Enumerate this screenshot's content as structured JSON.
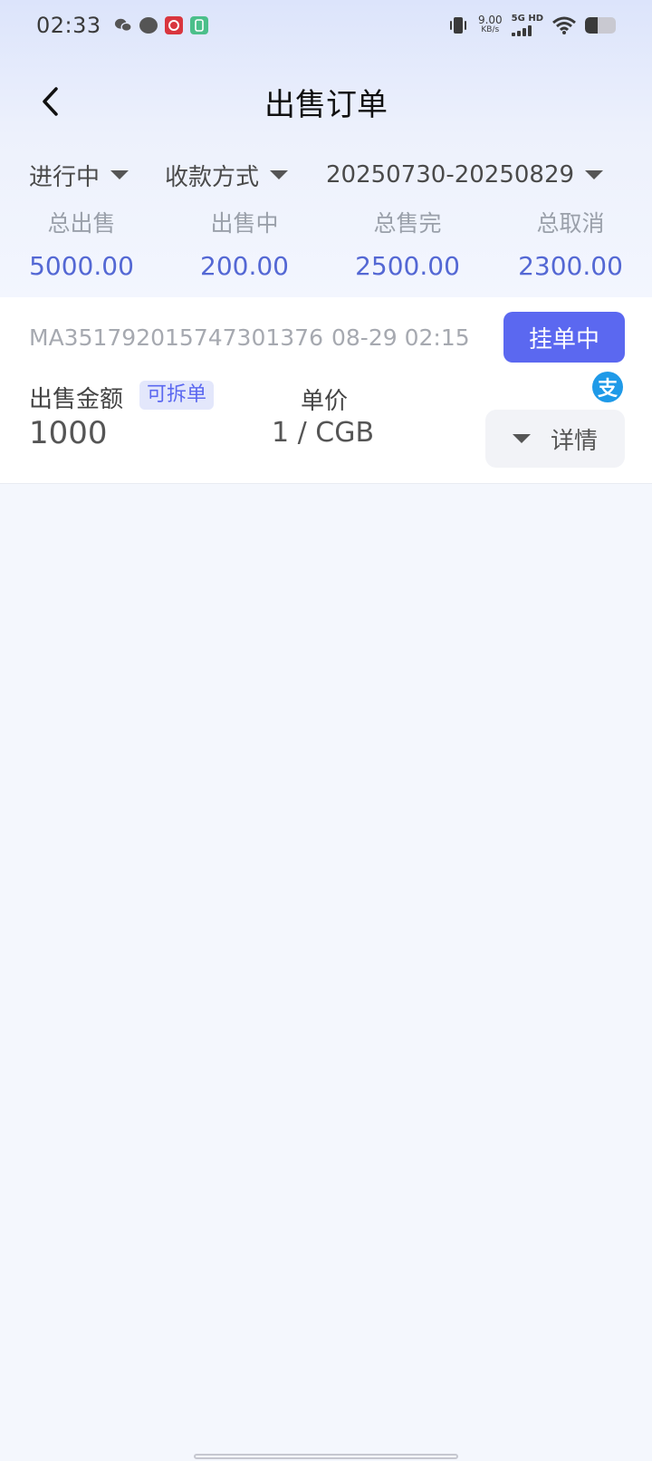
{
  "status_bar": {
    "time": "02:33",
    "speed_value": "9.00",
    "speed_unit": "KB/s",
    "network": "5G HD",
    "icons": [
      "wechat-icon",
      "message-icon",
      "red-app-icon",
      "green-app-icon",
      "vibrate-icon",
      "signal-icon",
      "wifi-icon",
      "battery-icon"
    ],
    "battery_level": 0.4
  },
  "header": {
    "title": "出售订单"
  },
  "filters": {
    "status": "进行中",
    "payment": "收款方式",
    "date_range": "20250730-20250829"
  },
  "summary": [
    {
      "label": "总出售",
      "value": "5000.00"
    },
    {
      "label": "出售中",
      "value": "200.00"
    },
    {
      "label": "总售完",
      "value": "2500.00"
    },
    {
      "label": "总取消",
      "value": "2300.00"
    }
  ],
  "order": {
    "order_no": "MA351792015747301376",
    "time": "08-29 02:15",
    "status": "挂单中",
    "amount_label": "出售金额",
    "split_badge": "可拆单",
    "amount": "1000",
    "price_label": "单价",
    "price": "1 / CGB",
    "payment_icon": "支",
    "detail_label": "详情"
  },
  "colors": {
    "accent": "#5b68f0",
    "value_blue": "#5468d4",
    "alipay": "#1f9ae8"
  }
}
